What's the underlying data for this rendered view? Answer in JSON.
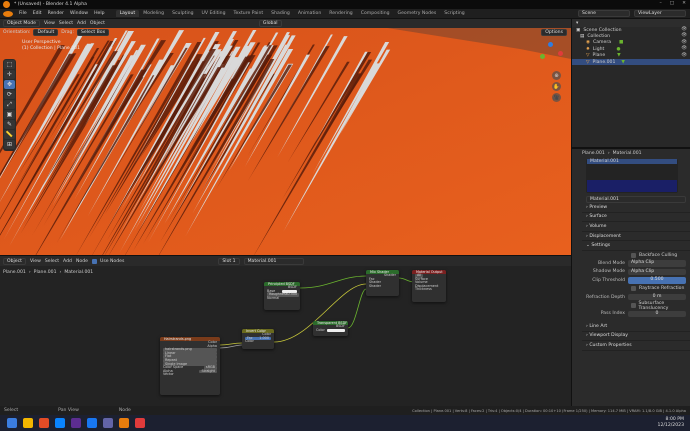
{
  "app": {
    "title": "* (Unsaved) - Blender 4.1 Alpha",
    "window_controls": [
      "–",
      "□",
      "✕"
    ]
  },
  "menu": [
    "File",
    "Edit",
    "Render",
    "Window",
    "Help"
  ],
  "workspace_tabs": [
    "Layout",
    "Modeling",
    "Sculpting",
    "UV Editing",
    "Texture Paint",
    "Shading",
    "Animation",
    "Rendering",
    "Compositing",
    "Geometry Nodes",
    "Scripting"
  ],
  "scene": {
    "label": "Scene",
    "view_layer": "ViewLayer"
  },
  "viewport": {
    "mode": "Object Mode",
    "menus": [
      "View",
      "Select",
      "Add",
      "Object"
    ],
    "orientation_label": "Orientation:",
    "orientation": "Default",
    "drag_label": "Drag:",
    "drag": "Select Box",
    "transform": "Global",
    "options": "Options",
    "overlay_title": "User Perspective",
    "overlay_sub": "(1) Collection | Plane.001",
    "tools": [
      "⬚",
      "✛",
      "✥",
      "⟳",
      "⤢",
      "▣",
      "✎",
      "📏",
      "⊞"
    ]
  },
  "node_editor": {
    "type": "Object",
    "menus": [
      "View",
      "Select",
      "Add",
      "Node"
    ],
    "use_nodes_label": "Use Nodes",
    "slot": "Slot 1",
    "material": "Material.001",
    "breadcrumb": [
      "Plane.001",
      "Plane.001",
      "Material.001"
    ],
    "nodes": {
      "principled": {
        "title": "Principled BSDF",
        "out": "BSDF",
        "rows": [
          "Base Color",
          "Roughness",
          "Normal"
        ],
        "roughness_val": "0.500"
      },
      "mix": {
        "title": "Mix Shader",
        "out": "Shader",
        "rows": [
          "Fac",
          "Shader",
          "Shader"
        ]
      },
      "output": {
        "title": "Material Output",
        "target": "All",
        "rows": [
          "Surface",
          "Volume",
          "Displacement",
          "Thickness"
        ]
      },
      "transparent": {
        "title": "Transparent BSDF",
        "out": "BSDF",
        "rows": [
          "Color"
        ]
      },
      "invert": {
        "title": "Invert Color",
        "out": "Color",
        "rows": [
          "Fac",
          "Color"
        ],
        "fac": "1.000"
      },
      "image": {
        "title": "Hairstrands.png",
        "outs": [
          "Color",
          "Alpha"
        ],
        "file": "hairstrands.png",
        "rows": [
          "Linear",
          "Flat",
          "Repeat",
          "Single Image",
          "Color Space",
          "Alpha",
          "Vector"
        ],
        "color_space": "sRGB",
        "alpha": "Straight"
      }
    }
  },
  "outliner": {
    "title": "Scene Collection",
    "items": [
      {
        "name": "Collection",
        "icon": "collection-icon",
        "color": "#cfcfcf"
      },
      {
        "name": "Camera",
        "icon": "camera-icon",
        "color": "#e3a14f"
      },
      {
        "name": "Light",
        "icon": "light-icon",
        "color": "#e3a14f"
      },
      {
        "name": "Plane",
        "icon": "mesh-icon",
        "color": "#e3a14f"
      },
      {
        "name": "Plane.001",
        "icon": "mesh-icon",
        "color": "#e3a14f"
      }
    ]
  },
  "properties": {
    "breadcrumb": [
      "Plane.001",
      "Material.001"
    ],
    "material_slot": "Material.001",
    "material_field": "Material.001",
    "sections_top": [
      "Preview",
      "Surface",
      "Volume",
      "Displacement"
    ],
    "settings_title": "Settings",
    "backface_culling": "Backface Culling",
    "blend_mode_label": "Blend Mode",
    "blend_mode": "Alpha Clip",
    "shadow_mode_label": "Shadow Mode",
    "shadow_mode": "Alpha Clip",
    "clip_threshold_label": "Clip Threshold",
    "clip_threshold": "0.500",
    "raytrace_refraction": "Raytrace Refraction",
    "refraction_depth_label": "Refraction Depth",
    "refraction_depth": "0 m",
    "subsurface_translucency": "Subsurface Translucency",
    "pass_index_label": "Pass Index",
    "pass_index": "0",
    "sections_bottom": [
      "Line Art",
      "Viewport Display",
      "Custom Properties"
    ]
  },
  "statusbar": {
    "left": [
      "Select",
      "Pan View",
      "Node"
    ],
    "right": "Collection | Plane.001 | Verts:8 | Faces:2 | Tris:4 | Objects:0/4 | Duration: 00:10+10 (Frame 1/250) | Memory: 114.7 MiB | VRAM: 1.1/8.0 GiB | 4.1.0 Alpha"
  },
  "taskbar": {
    "time": "8:00 PM",
    "date": "12/12/2023",
    "icons": [
      "#3b7de0",
      "#f2b600",
      "#e34c26",
      "#0a84ff",
      "#5c2d91",
      "#1877f2",
      "#6264a7",
      "#e87d0d",
      "#e03b3b"
    ]
  },
  "colors": {
    "accent": "#4772b3",
    "plane": "#e05a1a",
    "hair": "#d9d9d9",
    "node_shader": "#2b6b2b",
    "node_input": "#7a3b1a",
    "node_output": "#7a2020"
  }
}
